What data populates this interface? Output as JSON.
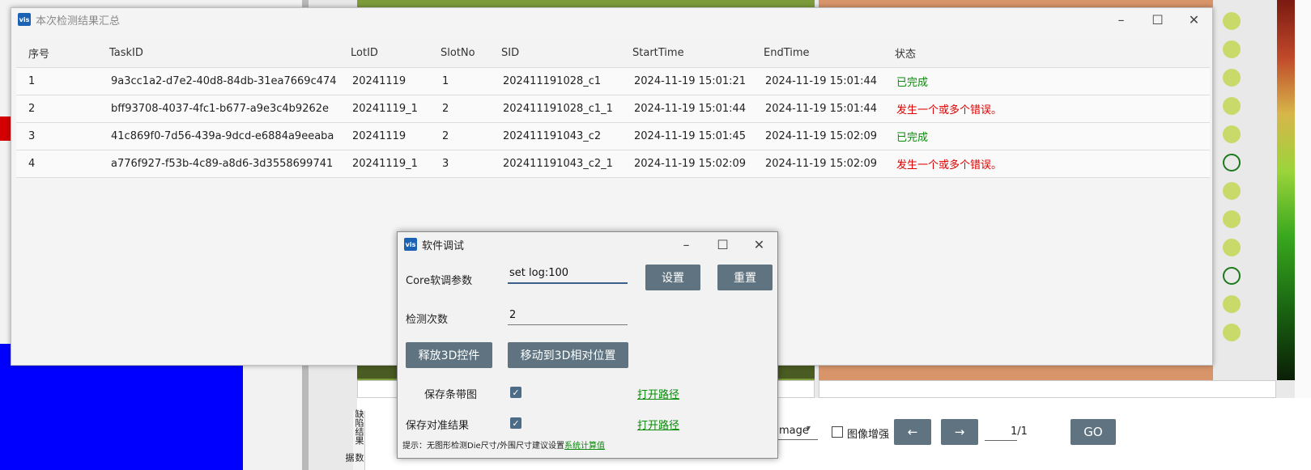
{
  "result_window": {
    "title": "本次检测结果汇总",
    "app_icon": "vis",
    "columns": [
      "序号",
      "TaskID",
      "LotID",
      "SlotNo",
      "SID",
      "StartTime",
      "EndTime",
      "状态"
    ],
    "rows": [
      {
        "no": "1",
        "task_id": "9a3cc1a2-d7e2-40d8-84db-31ea7669c474",
        "lot_id": "20241119",
        "slot_no": "1",
        "sid": "202411191028_c1",
        "start": "2024-11-19 15:01:21",
        "end": "2024-11-19 15:01:44",
        "status": "已完成",
        "status_ok": true
      },
      {
        "no": "2",
        "task_id": "bff93708-4037-4fc1-b677-a9e3c4b9262e",
        "lot_id": "20241119_1",
        "slot_no": "2",
        "sid": "202411191028_c1_1",
        "start": "2024-11-19 15:01:44",
        "end": "2024-11-19 15:01:44",
        "status": "发生一个或多个错误。",
        "status_ok": false
      },
      {
        "no": "3",
        "task_id": "41c869f0-7d56-439a-9dcd-e6884a9eeaba",
        "lot_id": "20241119",
        "slot_no": "2",
        "sid": "202411191043_c2",
        "start": "2024-11-19 15:01:45",
        "end": "2024-11-19 15:02:09",
        "status": "已完成",
        "status_ok": true
      },
      {
        "no": "4",
        "task_id": "a776f927-f53b-4c89-a8d6-3d3558699741",
        "lot_id": "20241119_1",
        "slot_no": "3",
        "sid": "202411191043_c2_1",
        "start": "2024-11-19 15:02:09",
        "end": "2024-11-19 15:02:09",
        "status": "发生一个或多个错误。",
        "status_ok": false
      }
    ]
  },
  "debug_dialog": {
    "title": "软件调试",
    "app_icon": "vis",
    "core_label": "Core软调参数",
    "core_value": "set log:100",
    "set_button": "设置",
    "reset_button": "重置",
    "count_label": "检测次数",
    "count_value": "2",
    "release_3d_button": "释放3D控件",
    "move_3d_button": "移动到3D相对位置",
    "save_strip_label": "保存条带图",
    "save_strip_checked": true,
    "save_align_label": "保存对准结果",
    "save_align_checked": true,
    "open_path_1": "打开路径",
    "open_path_2": "打开路径",
    "hint_text": "提示：无图形检测Die尺寸/外围尺寸建议设置",
    "hint_link": "系统计算值"
  },
  "background": {
    "image_select_value": "mage",
    "enhance_label": "图像增强",
    "prev_button": "←",
    "next_button": "→",
    "page_indicator": "1/1",
    "go_button": "GO",
    "side_tab_1": "缺陷结果",
    "side_tab_2": "数据"
  },
  "colors": {
    "status_ok": "#0a8a0a",
    "status_error": "#e00000",
    "button_bg": "#5f7480",
    "accent_blue": "#1b62b5"
  }
}
